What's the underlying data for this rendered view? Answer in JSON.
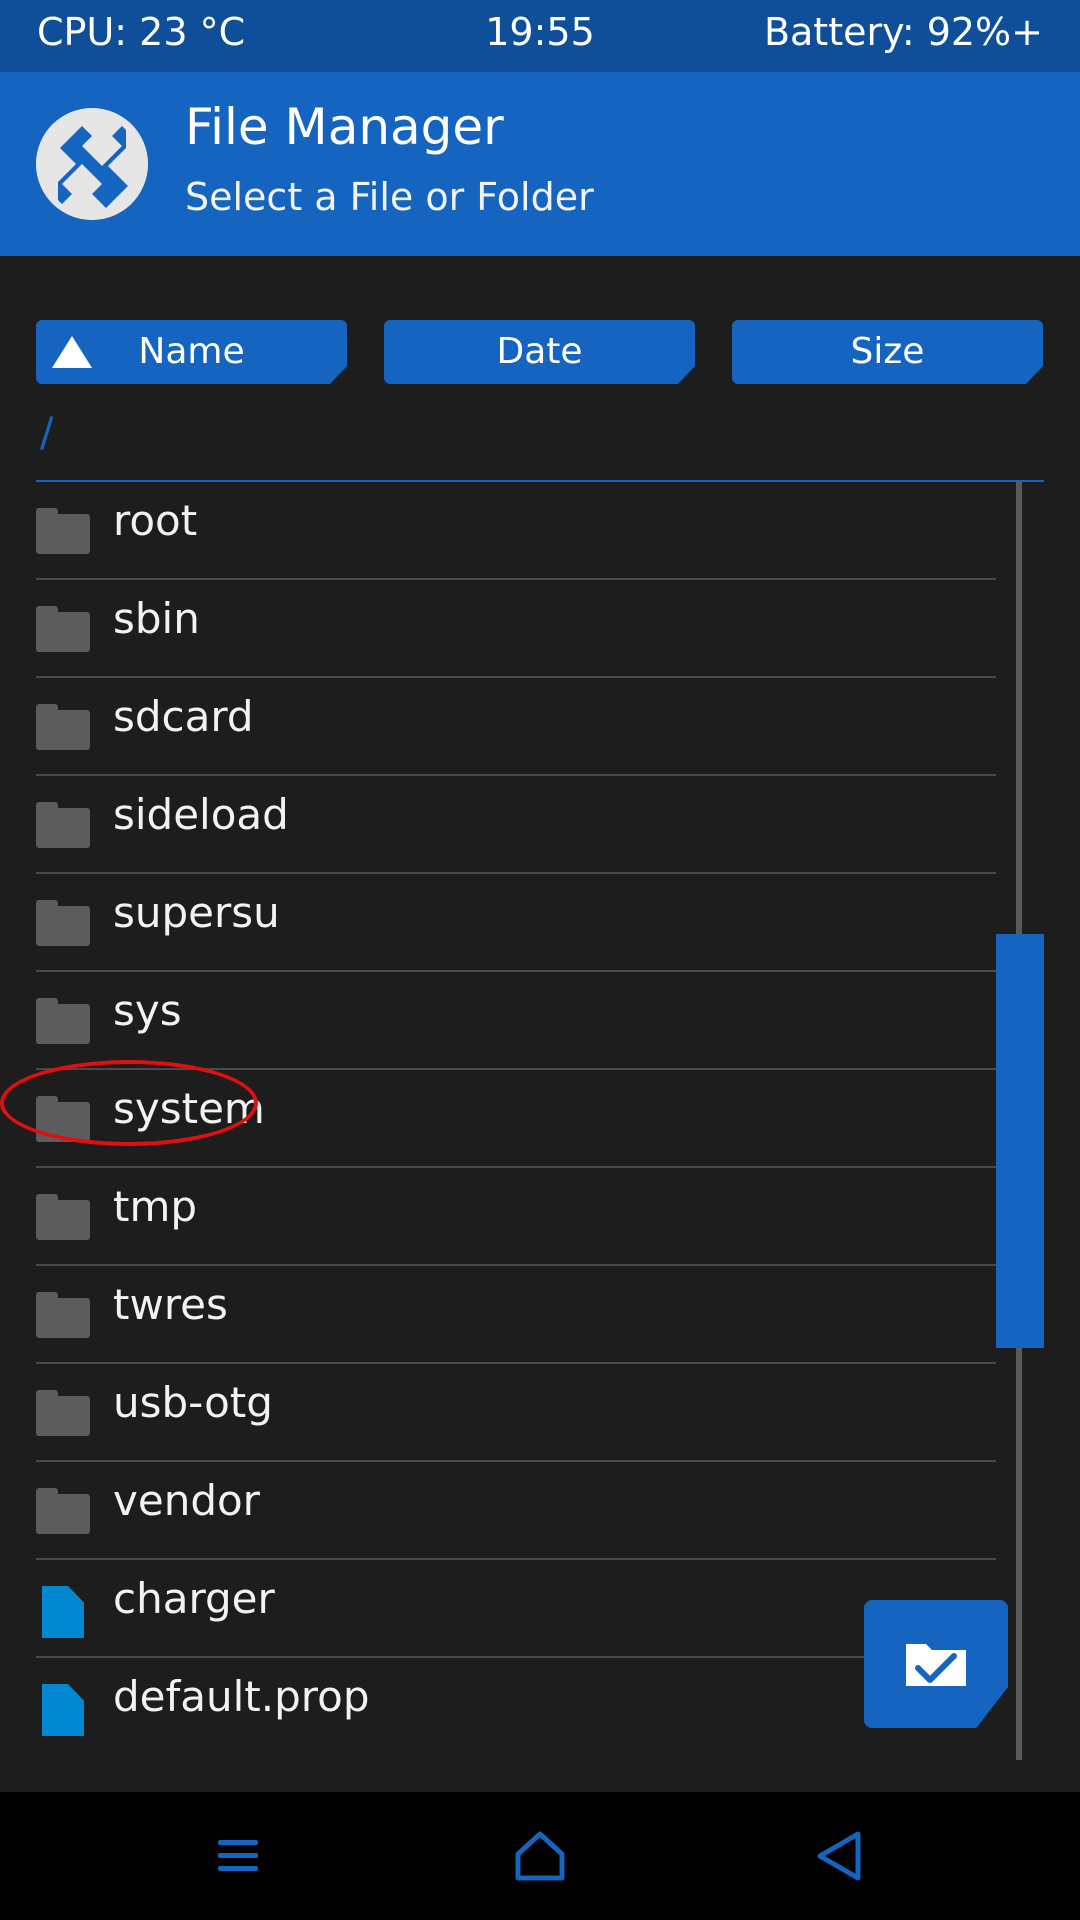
{
  "status_bar": {
    "cpu": "CPU: 23 °C",
    "time": "19:55",
    "battery": "Battery: 92%+"
  },
  "header": {
    "title": "File Manager",
    "subtitle": "Select a File or Folder",
    "logo_icon": "twrp-logo-icon"
  },
  "sort_buttons": [
    {
      "label": "Name",
      "icon": "sort-ascending-icon"
    },
    {
      "label": "Date"
    },
    {
      "label": "Size"
    }
  ],
  "current_path": "/",
  "items": [
    {
      "name": "root",
      "type": "folder"
    },
    {
      "name": "sbin",
      "type": "folder"
    },
    {
      "name": "sdcard",
      "type": "folder"
    },
    {
      "name": "sideload",
      "type": "folder"
    },
    {
      "name": "supersu",
      "type": "folder"
    },
    {
      "name": "sys",
      "type": "folder"
    },
    {
      "name": "system",
      "type": "folder"
    },
    {
      "name": "tmp",
      "type": "folder"
    },
    {
      "name": "twres",
      "type": "folder"
    },
    {
      "name": "usb-otg",
      "type": "folder"
    },
    {
      "name": "vendor",
      "type": "folder"
    },
    {
      "name": "charger",
      "type": "file"
    },
    {
      "name": "default.prop",
      "type": "file"
    }
  ],
  "fab": {
    "icon": "select-folder-check-icon"
  },
  "nav": [
    {
      "icon": "menu-icon"
    },
    {
      "icon": "home-icon"
    },
    {
      "icon": "back-icon"
    }
  ],
  "colors": {
    "accent": "#1565c0",
    "status_bar": "#0f4f99",
    "background": "#1d1d1d",
    "file_icon": "#0288d1",
    "folder_icon": "#5c5c5c",
    "highlight": "#e01010"
  }
}
